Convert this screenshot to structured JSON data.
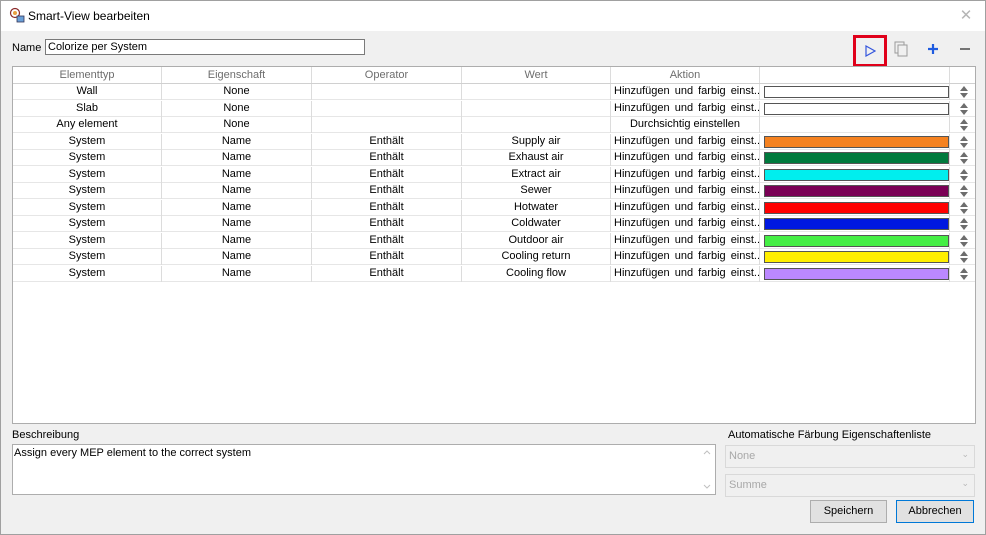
{
  "window": {
    "title": "Smart-View bearbeiten"
  },
  "name_field": {
    "label": "Name",
    "value": "Colorize per System"
  },
  "toolbar": {
    "run": "▷",
    "copy": "copy-icon",
    "add": "+",
    "remove": "−"
  },
  "columns": [
    "Elementtyp",
    "Eigenschaft",
    "Operator",
    "Wert",
    "Aktion",
    ""
  ],
  "rows": [
    {
      "type": "Wall",
      "property": "None",
      "operator": "",
      "value": "",
      "action": "Hinzufügen und farbig einst...",
      "color": "#ffffff"
    },
    {
      "type": "Slab",
      "property": "None",
      "operator": "",
      "value": "",
      "action": "Hinzufügen und farbig einst...",
      "color": "#ffffff"
    },
    {
      "type": "Any element",
      "property": "None",
      "operator": "",
      "value": "",
      "action": "Durchsichtig einstellen",
      "color": null
    },
    {
      "type": "System",
      "property": "Name",
      "operator": "Enthält",
      "value": "Supply air",
      "action": "Hinzufügen und farbig einst...",
      "color": "#f58220"
    },
    {
      "type": "System",
      "property": "Name",
      "operator": "Enthält",
      "value": "Exhaust air",
      "action": "Hinzufügen und farbig einst...",
      "color": "#007a3d"
    },
    {
      "type": "System",
      "property": "Name",
      "operator": "Enthält",
      "value": "Extract air",
      "action": "Hinzufügen und farbig einst...",
      "color": "#00eeee"
    },
    {
      "type": "System",
      "property": "Name",
      "operator": "Enthält",
      "value": "Sewer",
      "action": "Hinzufügen und farbig einst...",
      "color": "#7a0055"
    },
    {
      "type": "System",
      "property": "Name",
      "operator": "Enthält",
      "value": "Hotwater",
      "action": "Hinzufügen und farbig einst...",
      "color": "#ff0000"
    },
    {
      "type": "System",
      "property": "Name",
      "operator": "Enthält",
      "value": "Coldwater",
      "action": "Hinzufügen und farbig einst...",
      "color": "#0018e0"
    },
    {
      "type": "System",
      "property": "Name",
      "operator": "Enthält",
      "value": "Outdoor air",
      "action": "Hinzufügen und farbig einst...",
      "color": "#44ee44"
    },
    {
      "type": "System",
      "property": "Name",
      "operator": "Enthält",
      "value": "Cooling return",
      "action": "Hinzufügen und farbig einst...",
      "color": "#ffee00"
    },
    {
      "type": "System",
      "property": "Name",
      "operator": "Enthält",
      "value": "Cooling flow",
      "action": "Hinzufügen und farbig einst...",
      "color": "#bb88ff"
    }
  ],
  "description": {
    "label": "Beschreibung",
    "value": "Assign every MEP element to the correct system"
  },
  "auto_color": {
    "label": "Automatische Färbung Eigenschaftenliste",
    "select1": "None",
    "select2": "Summe"
  },
  "buttons": {
    "save": "Speichern",
    "cancel": "Abbrechen"
  },
  "colors": {
    "accent": "#0078d7",
    "highlight": "#e0001a",
    "add_icon": "#1f5ce0"
  }
}
